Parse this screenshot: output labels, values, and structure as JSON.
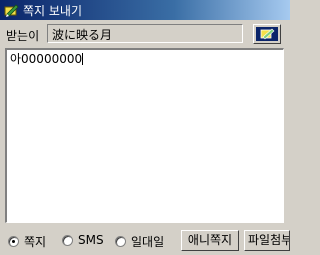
{
  "window": {
    "title": "쪽지 보내기",
    "icon": "note-pencil-icon"
  },
  "recipient": {
    "label": "받는이",
    "value": "波に映る月",
    "address_book_icon": "address-book-icon"
  },
  "message": {
    "text": "아00000000"
  },
  "send_mode": {
    "options": [
      {
        "label": "쪽지",
        "selected": true
      },
      {
        "label": "SMS",
        "selected": false
      },
      {
        "label": "일대일",
        "selected": false
      }
    ]
  },
  "buttons": {
    "anime_note": "애니쪽지",
    "attach_file": "파일첨부"
  },
  "colors": {
    "titlebar_start": "#0a246a",
    "titlebar_end": "#a6caf0",
    "window_face": "#d4d0c8"
  }
}
